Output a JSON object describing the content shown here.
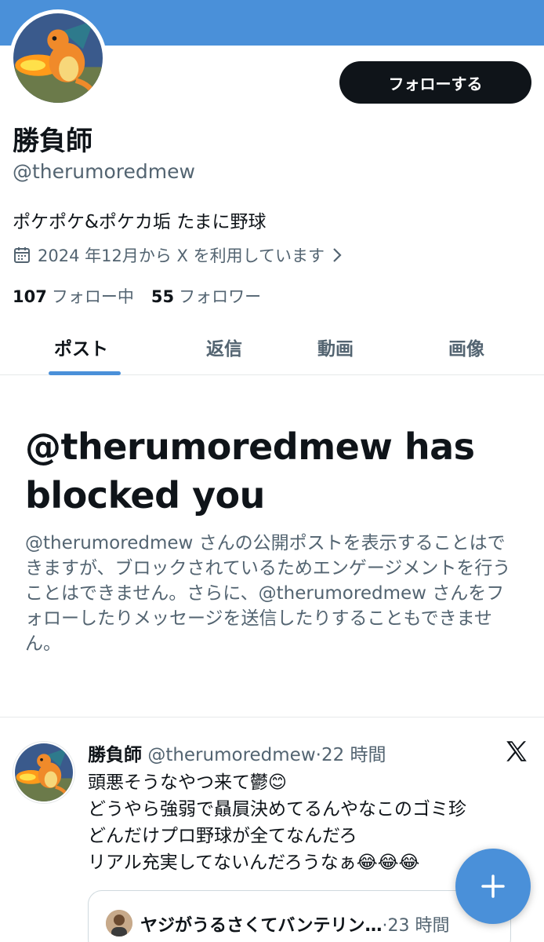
{
  "profile": {
    "display_name": "勝負師",
    "handle": "@therumoredmew",
    "bio": "ポケポケ&ポケカ垢 たまに野球",
    "joined": "2024 年12月から X を利用しています",
    "following_count": "107",
    "following_label": "フォロー中",
    "followers_count": "55",
    "followers_label": "フォロワー",
    "avatar_icon": "charizard-avatar-icon"
  },
  "actions": {
    "follow_label": "フォローする"
  },
  "tabs": [
    {
      "label": "ポスト",
      "active": true
    },
    {
      "label": "返信",
      "active": false
    },
    {
      "label": "動画",
      "active": false
    },
    {
      "label": "画像",
      "active": false
    }
  ],
  "blocked_notice": {
    "title": "@therumoredmew has blocked you",
    "body": "@therumoredmew さんの公開ポストを表示することはできますが、ブロックされているためエンゲージメントを行うことはできません。さらに、@therumoredmew さんをフォローしたりメッセージを送信したりすることもできません。"
  },
  "post": {
    "author_name": "勝負師",
    "author_handle": "@therumoredmew",
    "separator": "·",
    "time": "22 時間",
    "lines": [
      "頭悪そうなやつ来て鬱😊",
      "どうやら強弱で贔屓決めてるんやなこのゴミ珍",
      "どんだけプロ野球が全てなんだろ",
      "リアル充実してないんだろうなぁ😂😂😂"
    ],
    "quote": {
      "author_name": "ヤジがうるさくてバンテリン…",
      "separator": "·",
      "time": "23 時間"
    }
  },
  "colors": {
    "accent": "#4a90d9",
    "text": "#0f1419",
    "secondary": "#536471",
    "button_dark": "#0f1419"
  }
}
